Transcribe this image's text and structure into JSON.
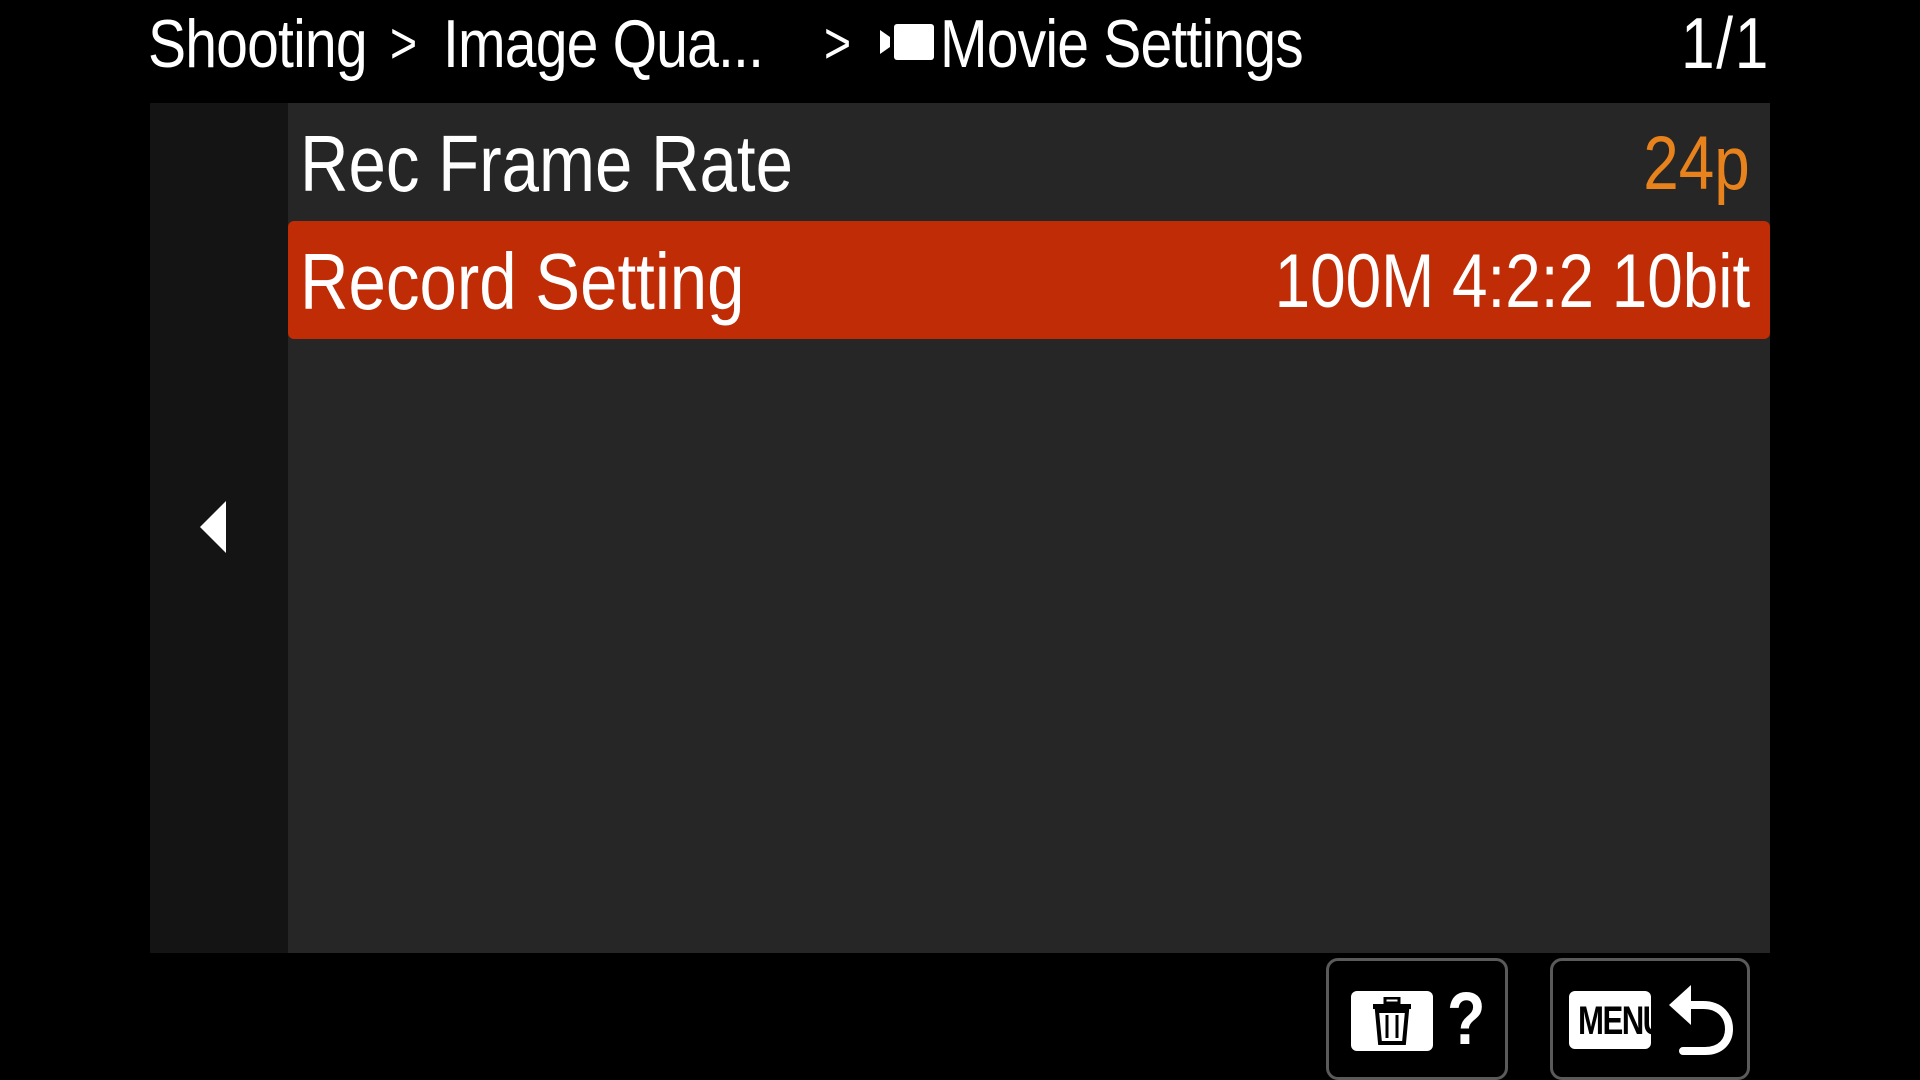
{
  "header": {
    "breadcrumb": [
      {
        "label": "Shooting"
      },
      {
        "label": "Image Qua..."
      },
      {
        "label": "Movie Settings",
        "icon": "movie-icon"
      }
    ],
    "separator": ">",
    "page_indicator": "1/1"
  },
  "nav": {
    "back_icon": "triangle-left-icon"
  },
  "menu_items": [
    {
      "label": "Rec Frame Rate",
      "value": "24p",
      "selected": false
    },
    {
      "label": "Record Setting",
      "value": "100M 4:2:2 10bit",
      "selected": true
    }
  ],
  "softkeys": {
    "delete_help": {
      "icon": "trash-icon",
      "glyph": "?"
    },
    "menu_return": {
      "label": "MENU",
      "icon": "return-arrow-icon"
    }
  },
  "colors": {
    "background": "#000000",
    "panel": "#262626",
    "left_strip": "#141414",
    "selection": "#bf2c05",
    "value_accent": "#e8821d",
    "text": "#ffffff"
  }
}
